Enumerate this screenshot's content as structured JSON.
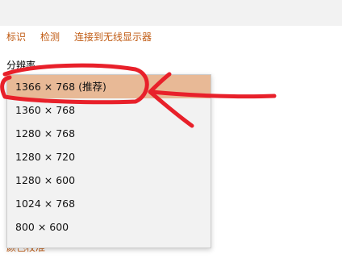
{
  "links": [
    "标识",
    "检测",
    "连接到无线显示器"
  ],
  "resolution_label": "分辨率",
  "resolution_options": [
    {
      "label": "1366 × 768 (推荐)",
      "selected": true
    },
    {
      "label": "1360 × 768",
      "selected": false
    },
    {
      "label": "1280 × 768",
      "selected": false
    },
    {
      "label": "1280 × 720",
      "selected": false
    },
    {
      "label": "1280 × 600",
      "selected": false
    },
    {
      "label": "1024 × 768",
      "selected": false
    },
    {
      "label": "800 × 600",
      "selected": false
    }
  ],
  "bottom_link": "颜色校准",
  "colors": {
    "link": "#c05a12",
    "selected_option": "#e8b996",
    "annotation": "#e8202a"
  }
}
